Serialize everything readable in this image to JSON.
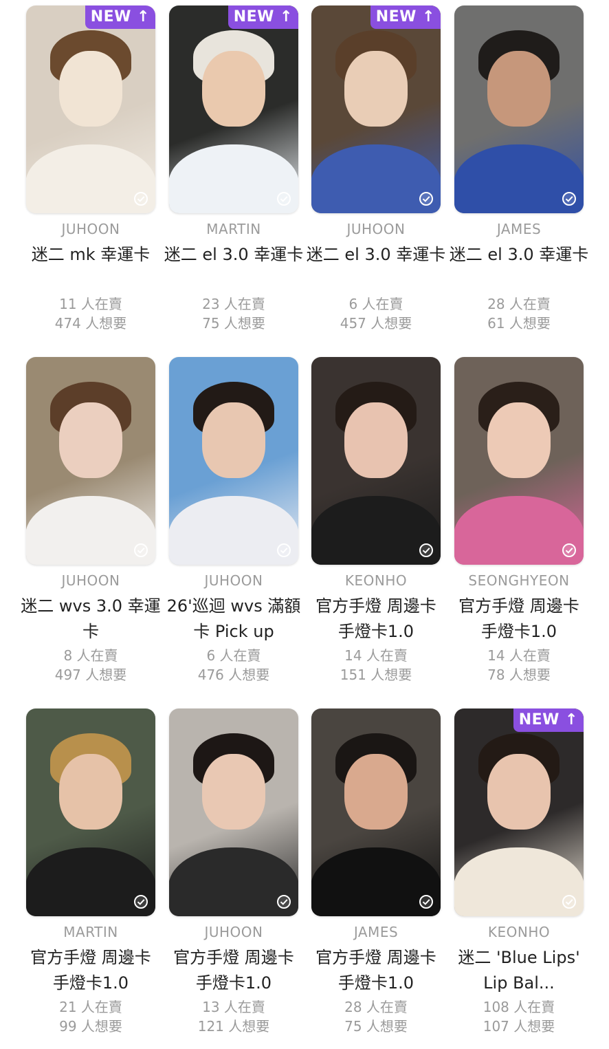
{
  "colors": {
    "new_badge": "#8a4fe0",
    "member_text": "#9b9b9b",
    "title_text": "#222222",
    "stat_text": "#9a9a9a"
  },
  "cards": [
    {
      "member": "JUHOON",
      "title": "迷二 mk 幸運卡",
      "sellers": "11 人在賣",
      "wants": "474 人想要",
      "new": true,
      "badge": "NEW ↑",
      "tone": [
        "#d9cfc2",
        "#f1e4d4",
        "#6b4a2e",
        "#f3eee6"
      ]
    },
    {
      "member": "MARTIN",
      "title": "迷二 el 3.0 幸運卡",
      "sellers": "23 人在賣",
      "wants": "75 人想要",
      "new": true,
      "badge": "NEW ↑",
      "tone": [
        "#2b2c2a",
        "#eac9ae",
        "#e8e4dc",
        "#eef2f6"
      ]
    },
    {
      "member": "JUHOON",
      "title": "迷二 el 3.0 幸運卡",
      "sellers": "6 人在賣",
      "wants": "457 人想要",
      "new": true,
      "badge": "NEW ↑",
      "tone": [
        "#5a4838",
        "#e9cdb6",
        "#5a3f2a",
        "#3e5cb0"
      ]
    },
    {
      "member": "JAMES",
      "title": "迷二 el 3.0 幸運卡",
      "sellers": "28 人在賣",
      "wants": "61 人想要",
      "new": false,
      "badge": "",
      "tone": [
        "#6f6f6e",
        "#c6977b",
        "#1f1c1a",
        "#2f4fa8"
      ]
    },
    {
      "member": "JUHOON",
      "title": "迷二 wvs 3.0 幸運卡",
      "sellers": "8 人在賣",
      "wants": "497 人想要",
      "new": false,
      "badge": "",
      "tone": [
        "#9a8a72",
        "#ebcfbf",
        "#5c3e29",
        "#f2f0ee"
      ]
    },
    {
      "member": "JUHOON",
      "title": "26'巡迴 wvs 滿額卡 Pick up",
      "sellers": "6 人在賣",
      "wants": "476 人想要",
      "new": false,
      "badge": "",
      "tone": [
        "#6aa0d4",
        "#e8c7b1",
        "#221a16",
        "#ecedf2"
      ]
    },
    {
      "member": "KEONHO",
      "title": "官方手燈 周邊卡 手燈卡1.0",
      "sellers": "14 人在賣",
      "wants": "151 人想要",
      "new": false,
      "badge": "",
      "tone": [
        "#3a3330",
        "#e8c3b0",
        "#241b16",
        "#1c1c1c"
      ]
    },
    {
      "member": "SEONGHYEON",
      "title": "官方手燈 周邊卡 手燈卡1.0",
      "sellers": "14 人在賣",
      "wants": "78 人想要",
      "new": false,
      "badge": "",
      "tone": [
        "#6e6259",
        "#edcab6",
        "#2a1f19",
        "#d8669a"
      ]
    },
    {
      "member": "MARTIN",
      "title": "官方手燈 周邊卡 手燈卡1.0",
      "sellers": "21 人在賣",
      "wants": "99 人想要",
      "new": false,
      "badge": "",
      "tone": [
        "#4e5a48",
        "#e6c2a8",
        "#b8904c",
        "#1c1c1c"
      ]
    },
    {
      "member": "JUHOON",
      "title": "官方手燈 周邊卡 手燈卡1.0",
      "sellers": "13 人在賣",
      "wants": "121 人想要",
      "new": false,
      "badge": "",
      "tone": [
        "#b9b4ae",
        "#e9c8b3",
        "#1d1715",
        "#2a2a2a"
      ]
    },
    {
      "member": "JAMES",
      "title": "官方手燈 周邊卡 手燈卡1.0",
      "sellers": "28 人在賣",
      "wants": "75 人想要",
      "new": false,
      "badge": "",
      "tone": [
        "#4a4540",
        "#d9a98e",
        "#1a1614",
        "#111111"
      ]
    },
    {
      "member": "KEONHO",
      "title": "迷二 'Blue Lips' Lip Bal...",
      "sellers": "108 人在賣",
      "wants": "107 人想要",
      "new": true,
      "badge": "NEW ↑",
      "tone": [
        "#2d2a2a",
        "#e8c4ae",
        "#231a15",
        "#efe7da"
      ]
    }
  ]
}
